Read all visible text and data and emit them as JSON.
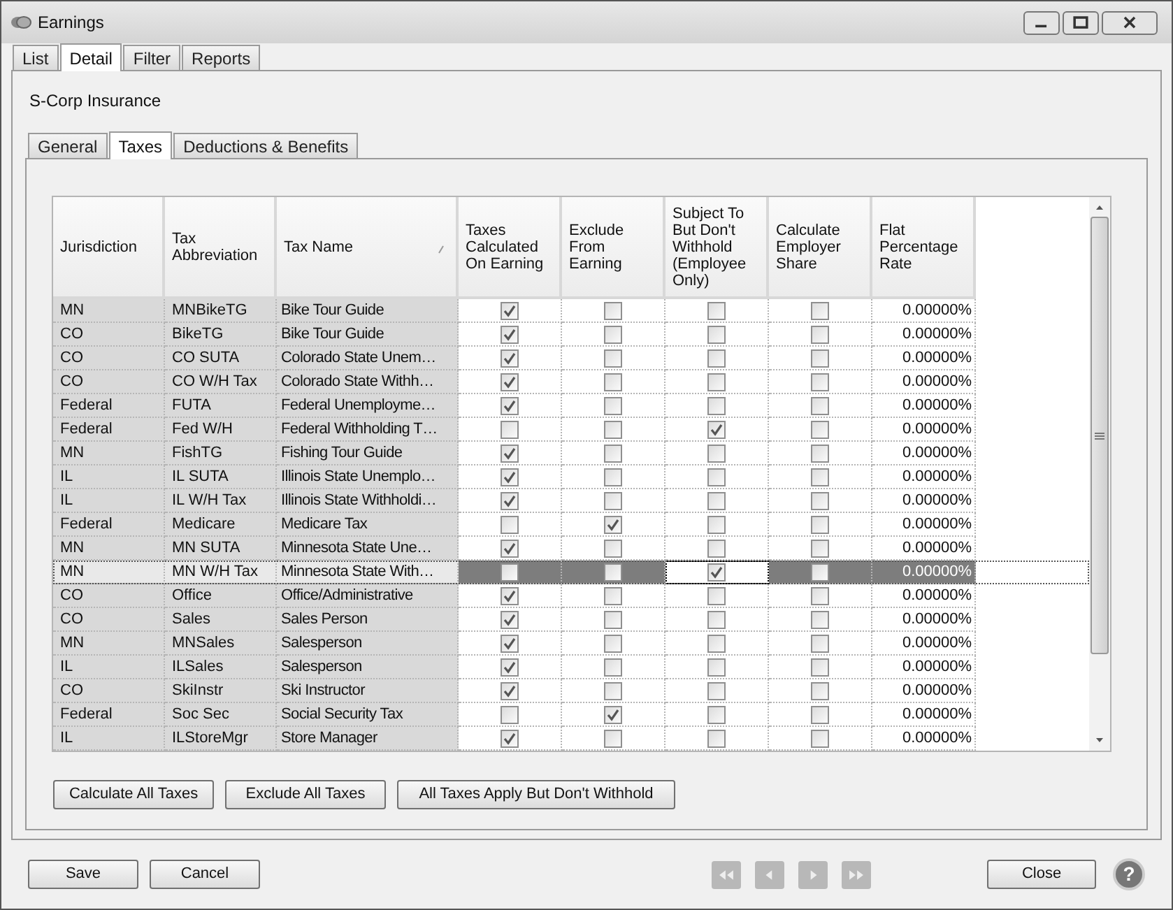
{
  "window": {
    "title": "Earnings"
  },
  "tabs": [
    {
      "label": "List",
      "selected": false
    },
    {
      "label": "Detail",
      "selected": true
    },
    {
      "label": "Filter",
      "selected": false
    },
    {
      "label": "Reports",
      "selected": false
    }
  ],
  "record_title": "S-Corp Insurance",
  "sub_tabs": [
    {
      "label": "General",
      "selected": false
    },
    {
      "label": "Taxes",
      "selected": true
    },
    {
      "label": "Deductions & Benefits",
      "selected": false
    }
  ],
  "table": {
    "columns": [
      "Jurisdiction",
      "Tax Abbreviation",
      "Tax Name",
      "Taxes Calculated On Earning",
      "Exclude From Earning",
      "Subject To But Don't Withhold (Employee Only)",
      "Calculate Employer Share",
      "Flat Percentage Rate"
    ],
    "rows": [
      {
        "jurisdiction": "MN",
        "abbreviation": "MNBikeTG",
        "name": "Bike Tour Guide",
        "calculated": true,
        "exclude": false,
        "subject": false,
        "employer": false,
        "rate": "0.00000%",
        "selected": false
      },
      {
        "jurisdiction": "CO",
        "abbreviation": "BikeTG",
        "name": "Bike Tour Guide",
        "calculated": true,
        "exclude": false,
        "subject": false,
        "employer": false,
        "rate": "0.00000%",
        "selected": false
      },
      {
        "jurisdiction": "CO",
        "abbreviation": "CO SUTA",
        "name": "Colorado State Unem…",
        "calculated": true,
        "exclude": false,
        "subject": false,
        "employer": false,
        "rate": "0.00000%",
        "selected": false
      },
      {
        "jurisdiction": "CO",
        "abbreviation": "CO W/H Tax",
        "name": "Colorado State Withh…",
        "calculated": true,
        "exclude": false,
        "subject": false,
        "employer": false,
        "rate": "0.00000%",
        "selected": false
      },
      {
        "jurisdiction": "Federal",
        "abbreviation": "FUTA",
        "name": "Federal Unemployme…",
        "calculated": true,
        "exclude": false,
        "subject": false,
        "employer": false,
        "rate": "0.00000%",
        "selected": false
      },
      {
        "jurisdiction": "Federal",
        "abbreviation": "Fed W/H",
        "name": "Federal Withholding T…",
        "calculated": false,
        "exclude": false,
        "subject": true,
        "employer": false,
        "rate": "0.00000%",
        "selected": false
      },
      {
        "jurisdiction": "MN",
        "abbreviation": "FishTG",
        "name": "Fishing Tour Guide",
        "calculated": true,
        "exclude": false,
        "subject": false,
        "employer": false,
        "rate": "0.00000%",
        "selected": false
      },
      {
        "jurisdiction": "IL",
        "abbreviation": "IL SUTA",
        "name": "Illinois State Unemplo…",
        "calculated": true,
        "exclude": false,
        "subject": false,
        "employer": false,
        "rate": "0.00000%",
        "selected": false
      },
      {
        "jurisdiction": "IL",
        "abbreviation": "IL W/H Tax",
        "name": "Illinois State Withholdi…",
        "calculated": true,
        "exclude": false,
        "subject": false,
        "employer": false,
        "rate": "0.00000%",
        "selected": false
      },
      {
        "jurisdiction": "Federal",
        "abbreviation": "Medicare",
        "name": "Medicare Tax",
        "calculated": false,
        "exclude": true,
        "subject": false,
        "employer": false,
        "rate": "0.00000%",
        "selected": false
      },
      {
        "jurisdiction": "MN",
        "abbreviation": "MN SUTA",
        "name": "Minnesota State Une…",
        "calculated": true,
        "exclude": false,
        "subject": false,
        "employer": false,
        "rate": "0.00000%",
        "selected": false
      },
      {
        "jurisdiction": "MN",
        "abbreviation": "MN W/H Tax",
        "name": "Minnesota State With…",
        "calculated": false,
        "exclude": false,
        "subject": true,
        "employer": false,
        "rate": "0.00000%",
        "selected": true
      },
      {
        "jurisdiction": "CO",
        "abbreviation": "Office",
        "name": "Office/Administrative",
        "calculated": true,
        "exclude": false,
        "subject": false,
        "employer": false,
        "rate": "0.00000%",
        "selected": false
      },
      {
        "jurisdiction": "CO",
        "abbreviation": "Sales",
        "name": "Sales Person",
        "calculated": true,
        "exclude": false,
        "subject": false,
        "employer": false,
        "rate": "0.00000%",
        "selected": false
      },
      {
        "jurisdiction": "MN",
        "abbreviation": "MNSales",
        "name": "Salesperson",
        "calculated": true,
        "exclude": false,
        "subject": false,
        "employer": false,
        "rate": "0.00000%",
        "selected": false
      },
      {
        "jurisdiction": "IL",
        "abbreviation": "ILSales",
        "name": "Salesperson",
        "calculated": true,
        "exclude": false,
        "subject": false,
        "employer": false,
        "rate": "0.00000%",
        "selected": false
      },
      {
        "jurisdiction": "CO",
        "abbreviation": "SkiInstr",
        "name": "Ski Instructor",
        "calculated": true,
        "exclude": false,
        "subject": false,
        "employer": false,
        "rate": "0.00000%",
        "selected": false
      },
      {
        "jurisdiction": "Federal",
        "abbreviation": "Soc Sec",
        "name": "Social Security Tax",
        "calculated": false,
        "exclude": true,
        "subject": false,
        "employer": false,
        "rate": "0.00000%",
        "selected": false
      },
      {
        "jurisdiction": "IL",
        "abbreviation": "ILStoreMgr",
        "name": "Store Manager",
        "calculated": true,
        "exclude": false,
        "subject": false,
        "employer": false,
        "rate": "0.00000%",
        "selected": false
      }
    ]
  },
  "action_buttons": [
    "Calculate All Taxes",
    "Exclude All Taxes",
    "All Taxes Apply But Don't Withhold"
  ],
  "footer": {
    "save": "Save",
    "cancel": "Cancel",
    "close": "Close",
    "help": "?"
  }
}
